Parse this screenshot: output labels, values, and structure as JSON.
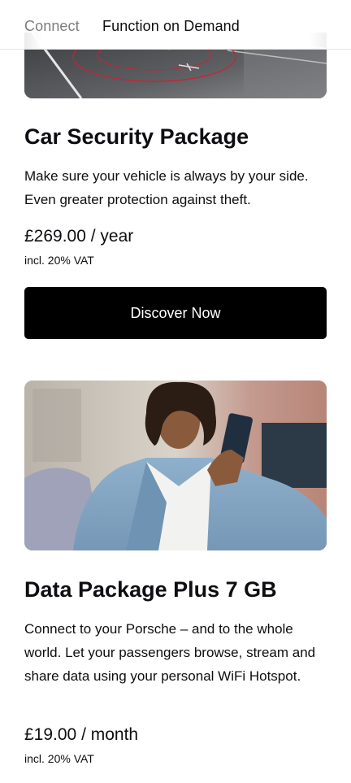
{
  "nav": {
    "tabs": [
      "Connect",
      "Function on Demand"
    ]
  },
  "packages": [
    {
      "title": "Car Security Package",
      "description": "Make sure your vehicle is always by your side. Even greater protection against theft.",
      "price": "£269.00 / year",
      "vat": "incl. 20% VAT",
      "cta": "Discover Now",
      "image": "car-security-photo"
    },
    {
      "title": "Data Package Plus 7 GB",
      "description": "Connect to your Porsche – and to the whole world. Let your passengers browse, stream and share data using your personal WiFi Hotspot.",
      "price": "£19.00 / month",
      "vat": "incl. 20% VAT",
      "image": "woman-using-smartphone-photo"
    }
  ],
  "colors": {
    "text": "#0e0e12",
    "inactive_tab": "#7c7c80",
    "button_bg": "#000000",
    "button_text": "#ffffff"
  }
}
